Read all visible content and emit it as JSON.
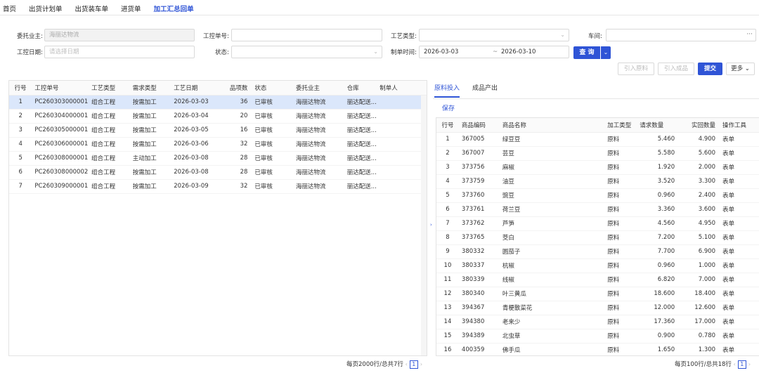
{
  "nav": [
    "首页",
    "出货计划单",
    "出货装车单",
    "进货单",
    "加工汇总回单"
  ],
  "nav_active": 4,
  "form": {
    "owner_label": "委托业主:",
    "owner_value": "海丽达物流",
    "workno_label": "工控单号:",
    "worktype_label": "工艺类型:",
    "workshop_label": "车间:",
    "workdate_label": "工控日期:",
    "workdate_placeholder": "请选择日期",
    "status_label": "状态:",
    "maketime_label": "制单时间:",
    "date_from": "2026-03-03",
    "date_to": "2026-03-10",
    "query_label": "查 询"
  },
  "toolbar": {
    "import_material": "引入原料",
    "import_product": "引入成品",
    "submit": "提交",
    "more": "更多"
  },
  "left_table": {
    "headers": [
      "行号",
      "工控单号",
      "工艺类型",
      "需求类型",
      "工艺日期",
      "品项数",
      "状态",
      "委托业主",
      "仓库",
      "制单人"
    ],
    "rows": [
      [
        "1",
        "PC260303000001",
        "组合工程",
        "按需加工",
        "2026-03-03",
        "36",
        "已审核",
        "海丽达物流",
        "丽达配送..."
      ],
      [
        "2",
        "PC260304000001",
        "组合工程",
        "按需加工",
        "2026-03-04",
        "20",
        "已审核",
        "海丽达物流",
        "丽达配送..."
      ],
      [
        "3",
        "PC260305000001",
        "组合工程",
        "按需加工",
        "2026-03-05",
        "16",
        "已审核",
        "海丽达物流",
        "丽达配送..."
      ],
      [
        "4",
        "PC260306000001",
        "组合工程",
        "按需加工",
        "2026-03-06",
        "32",
        "已审核",
        "海丽达物流",
        "丽达配送..."
      ],
      [
        "5",
        "PC260308000001",
        "组合工程",
        "主动加工",
        "2026-03-08",
        "28",
        "已审核",
        "海丽达物流",
        "丽达配送..."
      ],
      [
        "6",
        "PC260308000002",
        "组合工程",
        "按需加工",
        "2026-03-08",
        "28",
        "已审核",
        "海丽达物流",
        "丽达配送..."
      ],
      [
        "7",
        "PC260309000001",
        "组合工程",
        "按需加工",
        "2026-03-09",
        "32",
        "已审核",
        "海丽达物流",
        "丽达配送..."
      ]
    ],
    "pager_text": "每页2000行/总共7行",
    "page": "1"
  },
  "right": {
    "tabs": [
      "原料投入",
      "成品产出"
    ],
    "save": "保存",
    "headers": [
      "行号",
      "商品编码",
      "商品名称",
      "加工类型",
      "请求数量",
      "实回数量",
      "操作工具"
    ],
    "rows": [
      [
        "1",
        "367005",
        "绿豆豆",
        "原料",
        "5.460",
        "4.900",
        "表单"
      ],
      [
        "2",
        "367007",
        "芸豆",
        "原料",
        "5.580",
        "5.600",
        "表单"
      ],
      [
        "3",
        "373756",
        "麻椒",
        "原料",
        "1.920",
        "2.000",
        "表单"
      ],
      [
        "4",
        "373759",
        "油豆",
        "原料",
        "3.520",
        "3.300",
        "表单"
      ],
      [
        "5",
        "373760",
        "豌豆",
        "原料",
        "0.960",
        "2.400",
        "表单"
      ],
      [
        "6",
        "373761",
        "荷兰豆",
        "原料",
        "3.360",
        "3.600",
        "表单"
      ],
      [
        "7",
        "373762",
        "芦笋",
        "原料",
        "4.560",
        "4.950",
        "表单"
      ],
      [
        "8",
        "373765",
        "茭白",
        "原料",
        "7.200",
        "5.100",
        "表单"
      ],
      [
        "9",
        "380332",
        "圆茄子",
        "原料",
        "7.700",
        "6.900",
        "表单"
      ],
      [
        "10",
        "380337",
        "杭椒",
        "原料",
        "0.960",
        "1.000",
        "表单"
      ],
      [
        "11",
        "380339",
        "线椒",
        "原料",
        "6.820",
        "7.000",
        "表单"
      ],
      [
        "12",
        "380340",
        "叶三黄瓜",
        "原料",
        "18.600",
        "18.400",
        "表单"
      ],
      [
        "13",
        "394367",
        "青梗散菜花",
        "原料",
        "12.000",
        "12.600",
        "表单"
      ],
      [
        "14",
        "394380",
        "老来少",
        "原料",
        "17.360",
        "17.000",
        "表单"
      ],
      [
        "15",
        "394389",
        "北虫草",
        "原料",
        "0.900",
        "0.780",
        "表单"
      ],
      [
        "16",
        "400359",
        "佛手瓜",
        "原料",
        "1.650",
        "1.300",
        "表单"
      ]
    ],
    "pager_text": "每页100行/总共18行",
    "page": "1"
  }
}
